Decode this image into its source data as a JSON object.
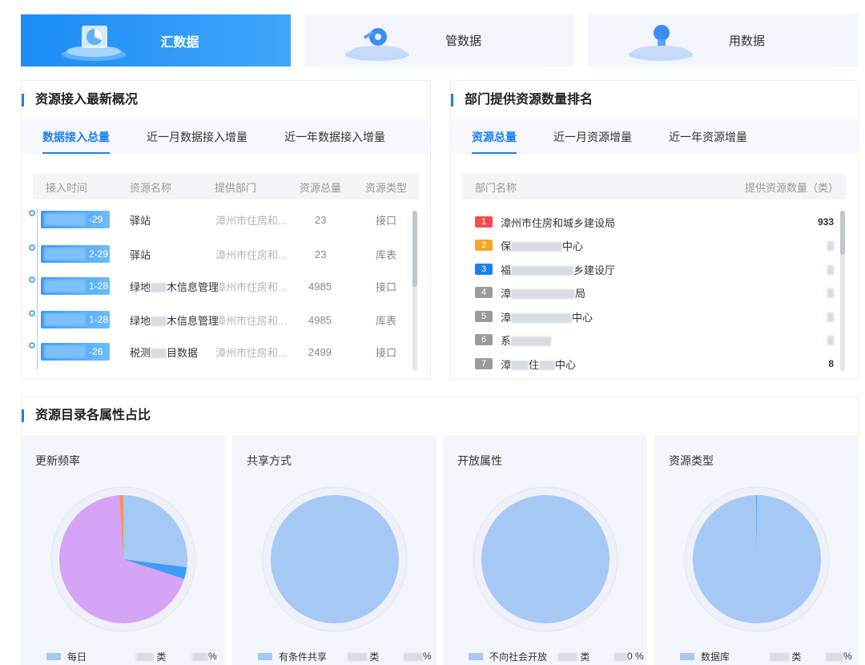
{
  "top_tabs": [
    {
      "label": "汇数据",
      "icon": "pie-chart-cube-icon",
      "active": true
    },
    {
      "label": "管数据",
      "icon": "gear-tools-icon",
      "active": false
    },
    {
      "label": "用数据",
      "icon": "lightbulb-icon",
      "active": false
    }
  ],
  "access_panel": {
    "title": "资源接入最新概况",
    "tabs": [
      "数据接入总量",
      "近一月数据接入增量",
      "近一年数据接入增量"
    ],
    "columns": [
      "接入时间",
      "资源名称",
      "提供部门",
      "资源总量",
      "资源类型"
    ],
    "rows": [
      {
        "date": "-29",
        "name": "驿站",
        "dept": "漳州市住房和...",
        "total": "23",
        "type": "接口"
      },
      {
        "date": "2-29",
        "name": "驿站",
        "dept": "漳州市住房和...",
        "total": "23",
        "type": "库表"
      },
      {
        "date": "1-28",
        "name": "绿地",
        "name2": "木信息管理",
        "dept": "漳州市住房和...",
        "total": "4985",
        "type": "接口"
      },
      {
        "date": "1-28",
        "name": "绿地",
        "name2": "木信息管理",
        "dept": "漳州市住房和...",
        "total": "4985",
        "type": "库表"
      },
      {
        "date": "-26",
        "name": "税测",
        "name2": "目数据",
        "dept": "漳州市住房和...",
        "total": "2499",
        "type": "接口"
      }
    ]
  },
  "rank_panel": {
    "title": "部门提供资源数量排名",
    "tabs": [
      "资源总量",
      "近一月资源增量",
      "近一年资源增量"
    ],
    "columns": [
      "部门名称",
      "提供资源数量（类）"
    ],
    "rows": [
      {
        "rank": "1",
        "name": "漳州市住房和城乡建设局",
        "value": "933",
        "color": "#f24e4e"
      },
      {
        "rank": "2",
        "name": "保",
        "name2": "中心",
        "value": "",
        "color": "#f5a623"
      },
      {
        "rank": "3",
        "name": "福",
        "name2": "乡建设厅",
        "value": "",
        "color": "#1c7ff0"
      },
      {
        "rank": "4",
        "name": "漳",
        "name2": "局",
        "value": "",
        "color": "#9b9b9b"
      },
      {
        "rank": "5",
        "name": "漳",
        "name2": "中心",
        "value": "",
        "color": "#9b9b9b"
      },
      {
        "rank": "6",
        "name": "系",
        "name2": "",
        "value": "",
        "color": "#9b9b9b"
      },
      {
        "rank": "7",
        "name": "漳",
        "name2": "住",
        "name3": "中心",
        "value": "8",
        "color": "#9b9b9b"
      }
    ]
  },
  "attr_panel": {
    "title": "资源目录各属性占比",
    "cards": [
      {
        "title": "更新频率",
        "legend": "每日",
        "count_unit": "类",
        "pct_unit": "%"
      },
      {
        "title": "共享方式",
        "legend": "有条件共享",
        "count_unit": "类",
        "pct_unit": "%"
      },
      {
        "title": "开放属性",
        "legend": "不向社会开放",
        "count_unit": "类",
        "pct_suffix": "0 %"
      },
      {
        "title": "资源类型",
        "legend": "数据库",
        "count_unit": "类",
        "pct_unit": "%"
      }
    ]
  },
  "colors": {
    "accent": "#1c7ff0",
    "pie_main": "#a5c8f5",
    "pie_purple": "#d6a4f7",
    "pie_blue": "#3d9cf5",
    "pie_orange": "#f7934d"
  },
  "chart_data": [
    {
      "type": "pie",
      "title": "更新频率",
      "slices": [
        {
          "name": "每日",
          "value": 0.27
        },
        {
          "name": "",
          "value": 0.03
        },
        {
          "name": "",
          "value": 0.69
        },
        {
          "name": "",
          "value": 0.01
        }
      ]
    },
    {
      "type": "pie",
      "title": "共享方式",
      "slices": [
        {
          "name": "有条件共享",
          "value": 1.0
        }
      ]
    },
    {
      "type": "pie",
      "title": "开放属性",
      "slices": [
        {
          "name": "不向社会开放",
          "value": 1.0
        }
      ]
    },
    {
      "type": "pie",
      "title": "资源类型",
      "slices": [
        {
          "name": "数据库",
          "value": 0.998
        },
        {
          "name": "",
          "value": 0.002
        }
      ]
    }
  ]
}
